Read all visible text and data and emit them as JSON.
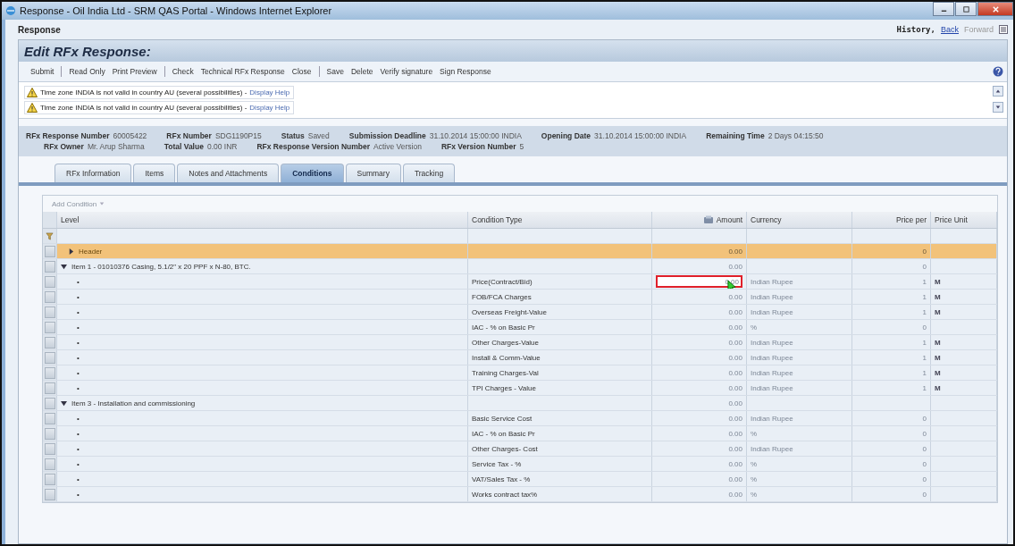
{
  "window": {
    "title": "Response - Oil India Ltd - SRM QAS Portal - Windows Internet Explorer"
  },
  "nav": {
    "page": "Response",
    "history": "History,",
    "back": "Back",
    "forward": "Forward"
  },
  "panel": {
    "title": "Edit RFx Response:"
  },
  "toolbar": [
    {
      "label": "Submit",
      "separator_after": true
    },
    {
      "label": "Read Only",
      "separator_after": false
    },
    {
      "label": "Print Preview",
      "separator_after": true
    },
    {
      "label": "Check",
      "separator_after": false
    },
    {
      "label": "Technical RFx Response",
      "separator_after": false
    },
    {
      "label": "Close",
      "separator_after": true
    },
    {
      "label": "Save",
      "separator_after": false
    },
    {
      "label": "Delete",
      "separator_after": false
    },
    {
      "label": "Verify signature",
      "separator_after": false
    },
    {
      "label": "Sign Response",
      "separator_after": false
    }
  ],
  "messages": [
    {
      "text": "Time zone INDIA is not valid in country AU (several possibilities) -",
      "link": "Display Help"
    },
    {
      "text": "Time zone INDIA is not valid in country AU (several possibilities) -",
      "link": "Display Help"
    }
  ],
  "summary": [
    [
      {
        "label": "RFx Response Number",
        "value": "60005422"
      },
      {
        "label": "RFx Number",
        "value": "SDG1190P15"
      },
      {
        "label": "Status",
        "value": "Saved"
      },
      {
        "label": "Submission Deadline",
        "value": "31.10.2014 15:00:00 INDIA"
      },
      {
        "label": "Opening Date",
        "value": "31.10.2014 15:00:00 INDIA"
      },
      {
        "label": "Remaining Time",
        "value": "2 Days 04:15:50"
      }
    ],
    [
      {
        "label": "RFx Owner",
        "value": "Mr. Arup Sharma"
      },
      {
        "label": "Total Value",
        "value": "0.00 INR"
      },
      {
        "label": "RFx Response Version Number",
        "value": "Active Version"
      },
      {
        "label": "RFx Version Number",
        "value": "5"
      }
    ]
  ],
  "tabs": [
    {
      "label": "RFx Information",
      "selected": false
    },
    {
      "label": "Items",
      "selected": false
    },
    {
      "label": "Notes and Attachments",
      "selected": false
    },
    {
      "label": "Conditions",
      "selected": true
    },
    {
      "label": "Summary",
      "selected": false
    },
    {
      "label": "Tracking",
      "selected": false
    }
  ],
  "table": {
    "add_button": "Add Condition",
    "columns": [
      "Level",
      "Condition Type",
      "Amount",
      "Currency",
      "Price per",
      "Price Unit"
    ],
    "rows": [
      {
        "kind": "header",
        "level": "Header",
        "condition_type": "",
        "amount": "0.00",
        "currency": "",
        "price_per": "0",
        "price_unit": "",
        "selected": false
      },
      {
        "kind": "item",
        "level": "Item 1 - 01010376 Casing, 5.1/2\" x 20 PPF x N-80, BTC.",
        "condition_type": "",
        "amount": "0.00",
        "currency": "",
        "price_per": "0",
        "price_unit": "",
        "selected": false
      },
      {
        "kind": "condition",
        "level": "•",
        "condition_type": "Price(Contract/Bid)",
        "amount": "0.00",
        "currency": "Indian Rupee",
        "price_per": "1",
        "price_unit": "M",
        "selected": true
      },
      {
        "kind": "condition",
        "level": "•",
        "condition_type": "FOB/FCA Charges",
        "amount": "0.00",
        "currency": "Indian Rupee",
        "price_per": "1",
        "price_unit": "M",
        "selected": false
      },
      {
        "kind": "condition",
        "level": "•",
        "condition_type": "Overseas Freight-Value",
        "amount": "0.00",
        "currency": "Indian Rupee",
        "price_per": "1",
        "price_unit": "M",
        "selected": false
      },
      {
        "kind": "condition",
        "level": "•",
        "condition_type": "IAC - % on Basic Pr",
        "amount": "0.00",
        "currency": "%",
        "price_per": "0",
        "price_unit": "",
        "selected": false
      },
      {
        "kind": "condition",
        "level": "•",
        "condition_type": "Other Charges-Value",
        "amount": "0.00",
        "currency": "Indian Rupee",
        "price_per": "1",
        "price_unit": "M",
        "selected": false
      },
      {
        "kind": "condition",
        "level": "•",
        "condition_type": "Install & Comm-Value",
        "amount": "0.00",
        "currency": "Indian Rupee",
        "price_per": "1",
        "price_unit": "M",
        "selected": false
      },
      {
        "kind": "condition",
        "level": "•",
        "condition_type": "Training Charges-Val",
        "amount": "0.00",
        "currency": "Indian Rupee",
        "price_per": "1",
        "price_unit": "M",
        "selected": false
      },
      {
        "kind": "condition",
        "level": "•",
        "condition_type": "TPI Charges - Value",
        "amount": "0.00",
        "currency": "Indian Rupee",
        "price_per": "1",
        "price_unit": "M",
        "selected": false
      },
      {
        "kind": "item",
        "level": "Item 3 - Installation and commissioning",
        "condition_type": "",
        "amount": "0.00",
        "currency": "",
        "price_per": "",
        "price_unit": "",
        "selected": false
      },
      {
        "kind": "condition",
        "level": "•",
        "condition_type": "Basic Service Cost",
        "amount": "0.00",
        "currency": "Indian Rupee",
        "price_per": "0",
        "price_unit": "",
        "selected": false
      },
      {
        "kind": "condition",
        "level": "•",
        "condition_type": "IAC - % on Basic Pr",
        "amount": "0.00",
        "currency": "%",
        "price_per": "0",
        "price_unit": "",
        "selected": false
      },
      {
        "kind": "condition",
        "level": "•",
        "condition_type": "Other Charges- Cost",
        "amount": "0.00",
        "currency": "Indian Rupee",
        "price_per": "0",
        "price_unit": "",
        "selected": false
      },
      {
        "kind": "condition",
        "level": "•",
        "condition_type": "Service Tax - %",
        "amount": "0.00",
        "currency": "%",
        "price_per": "0",
        "price_unit": "",
        "selected": false
      },
      {
        "kind": "condition",
        "level": "•",
        "condition_type": "VAT/Sales Tax - %",
        "amount": "0.00",
        "currency": "%",
        "price_per": "0",
        "price_unit": "",
        "selected": false
      },
      {
        "kind": "condition",
        "level": "•",
        "condition_type": "Works contract tax%",
        "amount": "0.00",
        "currency": "%",
        "price_per": "0",
        "price_unit": "",
        "selected": false
      }
    ]
  }
}
